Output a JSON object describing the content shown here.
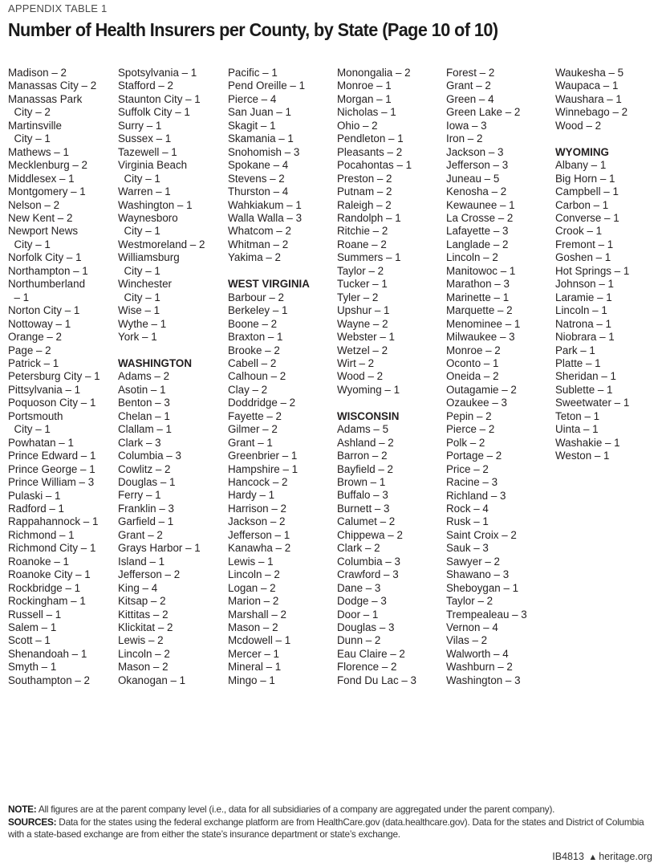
{
  "header": {
    "eyebrow": "APPENDIX TABLE 1",
    "title": "Number of Health Insurers per County, by State (Page 10 of 10)"
  },
  "columns": [
    [
      {
        "type": "entry",
        "text": "Madison – 2"
      },
      {
        "type": "entry",
        "text": "Manassas City – 2"
      },
      {
        "type": "entry",
        "text": "Manassas Park"
      },
      {
        "type": "entry",
        "text": "  City – 2"
      },
      {
        "type": "entry",
        "text": "Martinsville"
      },
      {
        "type": "entry",
        "text": "  City – 1"
      },
      {
        "type": "entry",
        "text": "Mathews – 1"
      },
      {
        "type": "entry",
        "text": "Mecklenburg – 2"
      },
      {
        "type": "entry",
        "text": "Middlesex – 1"
      },
      {
        "type": "entry",
        "text": "Montgomery – 1"
      },
      {
        "type": "entry",
        "text": "Nelson – 2"
      },
      {
        "type": "entry",
        "text": "New Kent – 2"
      },
      {
        "type": "entry",
        "text": "Newport News"
      },
      {
        "type": "entry",
        "text": "  City – 1"
      },
      {
        "type": "entry",
        "text": "Norfolk City – 1"
      },
      {
        "type": "entry",
        "text": "Northampton – 1"
      },
      {
        "type": "entry",
        "text": "Northumberland"
      },
      {
        "type": "entry",
        "text": "  – 1"
      },
      {
        "type": "entry",
        "text": "Norton City – 1"
      },
      {
        "type": "entry",
        "text": "Nottoway – 1"
      },
      {
        "type": "entry",
        "text": "Orange – 2"
      },
      {
        "type": "entry",
        "text": "Page – 2"
      },
      {
        "type": "entry",
        "text": "Patrick – 1"
      },
      {
        "type": "entry",
        "text": "Petersburg City – 1"
      },
      {
        "type": "entry",
        "text": "Pittsylvania – 1"
      },
      {
        "type": "entry",
        "text": "Poquoson City – 1"
      },
      {
        "type": "entry",
        "text": "Portsmouth"
      },
      {
        "type": "entry",
        "text": "  City – 1"
      },
      {
        "type": "entry",
        "text": "Powhatan – 1"
      },
      {
        "type": "entry",
        "text": "Prince Edward – 1"
      },
      {
        "type": "entry",
        "text": "Prince George – 1"
      },
      {
        "type": "entry",
        "text": "Prince William – 3"
      },
      {
        "type": "entry",
        "text": "Pulaski – 1"
      },
      {
        "type": "entry",
        "text": "Radford – 1"
      },
      {
        "type": "entry",
        "text": "Rappahannock – 1"
      },
      {
        "type": "entry",
        "text": "Richmond – 1"
      },
      {
        "type": "entry",
        "text": "Richmond City – 1"
      },
      {
        "type": "entry",
        "text": "Roanoke – 1"
      },
      {
        "type": "entry",
        "text": "Roanoke City – 1"
      },
      {
        "type": "entry",
        "text": "Rockbridge – 1"
      },
      {
        "type": "entry",
        "text": "Rockingham – 1"
      },
      {
        "type": "entry",
        "text": "Russell – 1"
      },
      {
        "type": "entry",
        "text": "Salem – 1"
      },
      {
        "type": "entry",
        "text": "Scott – 1"
      },
      {
        "type": "entry",
        "text": "Shenandoah – 1"
      },
      {
        "type": "entry",
        "text": "Smyth – 1"
      },
      {
        "type": "entry",
        "text": "Southampton – 2"
      }
    ],
    [
      {
        "type": "entry",
        "text": "Spotsylvania – 1"
      },
      {
        "type": "entry",
        "text": "Stafford – 2"
      },
      {
        "type": "entry",
        "text": "Staunton City – 1"
      },
      {
        "type": "entry",
        "text": "Suffolk City – 1"
      },
      {
        "type": "entry",
        "text": "Surry – 1"
      },
      {
        "type": "entry",
        "text": "Sussex – 1"
      },
      {
        "type": "entry",
        "text": "Tazewell – 1"
      },
      {
        "type": "entry",
        "text": "Virginia Beach"
      },
      {
        "type": "entry",
        "text": "  City – 1"
      },
      {
        "type": "entry",
        "text": "Warren – 1"
      },
      {
        "type": "entry",
        "text": "Washington – 1"
      },
      {
        "type": "entry",
        "text": "Waynesboro"
      },
      {
        "type": "entry",
        "text": "  City – 1"
      },
      {
        "type": "entry",
        "text": "Westmoreland – 2"
      },
      {
        "type": "entry",
        "text": "Williamsburg"
      },
      {
        "type": "entry",
        "text": "  City – 1"
      },
      {
        "type": "entry",
        "text": "Winchester"
      },
      {
        "type": "entry",
        "text": "  City – 1"
      },
      {
        "type": "entry",
        "text": "Wise – 1"
      },
      {
        "type": "entry",
        "text": "Wythe – 1"
      },
      {
        "type": "entry",
        "text": "York – 1"
      },
      {
        "type": "gap"
      },
      {
        "type": "state",
        "text": "WASHINGTON"
      },
      {
        "type": "entry",
        "text": "Adams – 2"
      },
      {
        "type": "entry",
        "text": "Asotin – 1"
      },
      {
        "type": "entry",
        "text": "Benton – 3"
      },
      {
        "type": "entry",
        "text": "Chelan – 1"
      },
      {
        "type": "entry",
        "text": "Clallam – 1"
      },
      {
        "type": "entry",
        "text": "Clark – 3"
      },
      {
        "type": "entry",
        "text": "Columbia – 3"
      },
      {
        "type": "entry",
        "text": "Cowlitz – 2"
      },
      {
        "type": "entry",
        "text": "Douglas – 1"
      },
      {
        "type": "entry",
        "text": "Ferry – 1"
      },
      {
        "type": "entry",
        "text": "Franklin – 3"
      },
      {
        "type": "entry",
        "text": "Garfield – 1"
      },
      {
        "type": "entry",
        "text": "Grant – 2"
      },
      {
        "type": "entry",
        "text": "Grays Harbor – 1"
      },
      {
        "type": "entry",
        "text": "Island – 1"
      },
      {
        "type": "entry",
        "text": "Jefferson – 2"
      },
      {
        "type": "entry",
        "text": "King – 4"
      },
      {
        "type": "entry",
        "text": "Kitsap – 2"
      },
      {
        "type": "entry",
        "text": "Kittitas – 2"
      },
      {
        "type": "entry",
        "text": "Klickitat – 2"
      },
      {
        "type": "entry",
        "text": "Lewis – 2"
      },
      {
        "type": "entry",
        "text": "Lincoln – 2"
      },
      {
        "type": "entry",
        "text": "Mason – 2"
      },
      {
        "type": "entry",
        "text": "Okanogan – 1"
      }
    ],
    [
      {
        "type": "entry",
        "text": "Pacific – 1"
      },
      {
        "type": "entry",
        "text": "Pend Oreille – 1"
      },
      {
        "type": "entry",
        "text": "Pierce – 4"
      },
      {
        "type": "entry",
        "text": "San Juan – 1"
      },
      {
        "type": "entry",
        "text": "Skagit – 1"
      },
      {
        "type": "entry",
        "text": "Skamania – 1"
      },
      {
        "type": "entry",
        "text": "Snohomish – 3"
      },
      {
        "type": "entry",
        "text": "Spokane – 4"
      },
      {
        "type": "entry",
        "text": "Stevens – 2"
      },
      {
        "type": "entry",
        "text": "Thurston – 4"
      },
      {
        "type": "entry",
        "text": "Wahkiakum – 1"
      },
      {
        "type": "entry",
        "text": "Walla Walla – 3"
      },
      {
        "type": "entry",
        "text": "Whatcom – 2"
      },
      {
        "type": "entry",
        "text": "Whitman – 2"
      },
      {
        "type": "entry",
        "text": "Yakima – 2"
      },
      {
        "type": "gap"
      },
      {
        "type": "state",
        "text": "WEST VIRGINIA"
      },
      {
        "type": "entry",
        "text": "Barbour – 2"
      },
      {
        "type": "entry",
        "text": "Berkeley – 1"
      },
      {
        "type": "entry",
        "text": "Boone – 2"
      },
      {
        "type": "entry",
        "text": "Braxton – 1"
      },
      {
        "type": "entry",
        "text": "Brooke – 2"
      },
      {
        "type": "entry",
        "text": "Cabell – 2"
      },
      {
        "type": "entry",
        "text": "Calhoun – 2"
      },
      {
        "type": "entry",
        "text": "Clay – 2"
      },
      {
        "type": "entry",
        "text": "Doddridge – 2"
      },
      {
        "type": "entry",
        "text": "Fayette – 2"
      },
      {
        "type": "entry",
        "text": "Gilmer – 2"
      },
      {
        "type": "entry",
        "text": "Grant – 1"
      },
      {
        "type": "entry",
        "text": "Greenbrier – 1"
      },
      {
        "type": "entry",
        "text": "Hampshire – 1"
      },
      {
        "type": "entry",
        "text": "Hancock – 2"
      },
      {
        "type": "entry",
        "text": "Hardy – 1"
      },
      {
        "type": "entry",
        "text": "Harrison – 2"
      },
      {
        "type": "entry",
        "text": "Jackson – 2"
      },
      {
        "type": "entry",
        "text": "Jefferson – 1"
      },
      {
        "type": "entry",
        "text": "Kanawha – 2"
      },
      {
        "type": "entry",
        "text": "Lewis – 1"
      },
      {
        "type": "entry",
        "text": "Lincoln – 2"
      },
      {
        "type": "entry",
        "text": "Logan – 2"
      },
      {
        "type": "entry",
        "text": "Marion – 2"
      },
      {
        "type": "entry",
        "text": "Marshall – 2"
      },
      {
        "type": "entry",
        "text": "Mason – 2"
      },
      {
        "type": "entry",
        "text": "Mcdowell – 1"
      },
      {
        "type": "entry",
        "text": "Mercer – 1"
      },
      {
        "type": "entry",
        "text": "Mineral – 1"
      },
      {
        "type": "entry",
        "text": "Mingo – 1"
      }
    ],
    [
      {
        "type": "entry",
        "text": "Monongalia – 2"
      },
      {
        "type": "entry",
        "text": "Monroe – 1"
      },
      {
        "type": "entry",
        "text": "Morgan – 1"
      },
      {
        "type": "entry",
        "text": "Nicholas – 1"
      },
      {
        "type": "entry",
        "text": "Ohio – 2"
      },
      {
        "type": "entry",
        "text": "Pendleton – 1"
      },
      {
        "type": "entry",
        "text": "Pleasants – 2"
      },
      {
        "type": "entry",
        "text": "Pocahontas – 1"
      },
      {
        "type": "entry",
        "text": "Preston – 2"
      },
      {
        "type": "entry",
        "text": "Putnam – 2"
      },
      {
        "type": "entry",
        "text": "Raleigh – 2"
      },
      {
        "type": "entry",
        "text": "Randolph – 1"
      },
      {
        "type": "entry",
        "text": "Ritchie – 2"
      },
      {
        "type": "entry",
        "text": "Roane – 2"
      },
      {
        "type": "entry",
        "text": "Summers – 1"
      },
      {
        "type": "entry",
        "text": "Taylor – 2"
      },
      {
        "type": "entry",
        "text": "Tucker – 1"
      },
      {
        "type": "entry",
        "text": "Tyler – 2"
      },
      {
        "type": "entry",
        "text": "Upshur – 1"
      },
      {
        "type": "entry",
        "text": "Wayne – 2"
      },
      {
        "type": "entry",
        "text": "Webster – 1"
      },
      {
        "type": "entry",
        "text": "Wetzel – 2"
      },
      {
        "type": "entry",
        "text": "Wirt – 2"
      },
      {
        "type": "entry",
        "text": "Wood – 2"
      },
      {
        "type": "entry",
        "text": "Wyoming – 1"
      },
      {
        "type": "gap"
      },
      {
        "type": "state",
        "text": "WISCONSIN"
      },
      {
        "type": "entry",
        "text": "Adams – 5"
      },
      {
        "type": "entry",
        "text": "Ashland – 2"
      },
      {
        "type": "entry",
        "text": "Barron – 2"
      },
      {
        "type": "entry",
        "text": "Bayfield – 2"
      },
      {
        "type": "entry",
        "text": "Brown – 1"
      },
      {
        "type": "entry",
        "text": "Buffalo – 3"
      },
      {
        "type": "entry",
        "text": "Burnett – 3"
      },
      {
        "type": "entry",
        "text": "Calumet – 2"
      },
      {
        "type": "entry",
        "text": "Chippewa – 2"
      },
      {
        "type": "entry",
        "text": "Clark – 2"
      },
      {
        "type": "entry",
        "text": "Columbia – 3"
      },
      {
        "type": "entry",
        "text": "Crawford – 3"
      },
      {
        "type": "entry",
        "text": "Dane – 3"
      },
      {
        "type": "entry",
        "text": "Dodge – 3"
      },
      {
        "type": "entry",
        "text": "Door – 1"
      },
      {
        "type": "entry",
        "text": "Douglas – 3"
      },
      {
        "type": "entry",
        "text": "Dunn – 2"
      },
      {
        "type": "entry",
        "text": "Eau Claire – 2"
      },
      {
        "type": "entry",
        "text": "Florence – 2"
      },
      {
        "type": "entry",
        "text": "Fond Du Lac – 3"
      }
    ],
    [
      {
        "type": "entry",
        "text": "Forest – 2"
      },
      {
        "type": "entry",
        "text": "Grant – 2"
      },
      {
        "type": "entry",
        "text": "Green – 4"
      },
      {
        "type": "entry",
        "text": "Green Lake – 2"
      },
      {
        "type": "entry",
        "text": "Iowa – 3"
      },
      {
        "type": "entry",
        "text": "Iron – 2"
      },
      {
        "type": "entry",
        "text": "Jackson – 3"
      },
      {
        "type": "entry",
        "text": "Jefferson – 3"
      },
      {
        "type": "entry",
        "text": "Juneau – 5"
      },
      {
        "type": "entry",
        "text": "Kenosha – 2"
      },
      {
        "type": "entry",
        "text": "Kewaunee – 1"
      },
      {
        "type": "entry",
        "text": "La Crosse – 2"
      },
      {
        "type": "entry",
        "text": "Lafayette – 3"
      },
      {
        "type": "entry",
        "text": "Langlade – 2"
      },
      {
        "type": "entry",
        "text": "Lincoln – 2"
      },
      {
        "type": "entry",
        "text": "Manitowoc – 1"
      },
      {
        "type": "entry",
        "text": "Marathon – 3"
      },
      {
        "type": "entry",
        "text": "Marinette – 1"
      },
      {
        "type": "entry",
        "text": "Marquette – 2"
      },
      {
        "type": "entry",
        "text": "Menominee – 1"
      },
      {
        "type": "entry",
        "text": "Milwaukee – 3"
      },
      {
        "type": "entry",
        "text": "Monroe – 2"
      },
      {
        "type": "entry",
        "text": "Oconto – 1"
      },
      {
        "type": "entry",
        "text": "Oneida – 2"
      },
      {
        "type": "entry",
        "text": "Outagamie – 2"
      },
      {
        "type": "entry",
        "text": "Ozaukee – 3"
      },
      {
        "type": "entry",
        "text": "Pepin – 2"
      },
      {
        "type": "entry",
        "text": "Pierce – 2"
      },
      {
        "type": "entry",
        "text": "Polk – 2"
      },
      {
        "type": "entry",
        "text": "Portage – 2"
      },
      {
        "type": "entry",
        "text": "Price – 2"
      },
      {
        "type": "entry",
        "text": "Racine – 3"
      },
      {
        "type": "entry",
        "text": "Richland – 3"
      },
      {
        "type": "entry",
        "text": "Rock – 4"
      },
      {
        "type": "entry",
        "text": "Rusk – 1"
      },
      {
        "type": "entry",
        "text": "Saint Croix – 2"
      },
      {
        "type": "entry",
        "text": "Sauk – 3"
      },
      {
        "type": "entry",
        "text": "Sawyer – 2"
      },
      {
        "type": "entry",
        "text": "Shawano – 3"
      },
      {
        "type": "entry",
        "text": "Sheboygan – 1"
      },
      {
        "type": "entry",
        "text": "Taylor – 2"
      },
      {
        "type": "entry",
        "text": "Trempealeau – 3"
      },
      {
        "type": "entry",
        "text": "Vernon – 4"
      },
      {
        "type": "entry",
        "text": "Vilas – 2"
      },
      {
        "type": "entry",
        "text": "Walworth – 4"
      },
      {
        "type": "entry",
        "text": "Washburn – 2"
      },
      {
        "type": "entry",
        "text": "Washington – 3"
      }
    ],
    [
      {
        "type": "entry",
        "text": "Waukesha – 5"
      },
      {
        "type": "entry",
        "text": "Waupaca – 1"
      },
      {
        "type": "entry",
        "text": "Waushara – 1"
      },
      {
        "type": "entry",
        "text": "Winnebago – 2"
      },
      {
        "type": "entry",
        "text": "Wood – 2"
      },
      {
        "type": "gap"
      },
      {
        "type": "state",
        "text": "WYOMING"
      },
      {
        "type": "entry",
        "text": "Albany – 1"
      },
      {
        "type": "entry",
        "text": "Big Horn – 1"
      },
      {
        "type": "entry",
        "text": "Campbell – 1"
      },
      {
        "type": "entry",
        "text": "Carbon – 1"
      },
      {
        "type": "entry",
        "text": "Converse – 1"
      },
      {
        "type": "entry",
        "text": "Crook – 1"
      },
      {
        "type": "entry",
        "text": "Fremont – 1"
      },
      {
        "type": "entry",
        "text": "Goshen – 1"
      },
      {
        "type": "entry",
        "text": "Hot Springs – 1"
      },
      {
        "type": "entry",
        "text": "Johnson – 1"
      },
      {
        "type": "entry",
        "text": "Laramie – 1"
      },
      {
        "type": "entry",
        "text": "Lincoln – 1"
      },
      {
        "type": "entry",
        "text": "Natrona – 1"
      },
      {
        "type": "entry",
        "text": "Niobrara – 1"
      },
      {
        "type": "entry",
        "text": "Park – 1"
      },
      {
        "type": "entry",
        "text": "Platte – 1"
      },
      {
        "type": "entry",
        "text": "Sheridan – 1"
      },
      {
        "type": "entry",
        "text": "Sublette – 1"
      },
      {
        "type": "entry",
        "text": "Sweetwater – 1"
      },
      {
        "type": "entry",
        "text": "Teton – 1"
      },
      {
        "type": "entry",
        "text": "Uinta – 1"
      },
      {
        "type": "entry",
        "text": "Washakie – 1"
      },
      {
        "type": "entry",
        "text": "Weston – 1"
      }
    ]
  ],
  "footnotes": {
    "note_label": "NOTE:",
    "note_text": " All figures are at the parent company level (i.e., data for all subsidiaries of a company are aggregated under the parent company).",
    "sources_label": "SOURCES:",
    "sources_text": " Data for the states using the federal exchange platform are from HealthCare.gov (data.healthcare.gov). Data for the states and District of Columbia with a state-based exchange are from either the state’s insurance department or state’s exchange."
  },
  "footer": {
    "code": "IB4813",
    "icon": "liberty-bell-icon",
    "site": "heritage.org"
  }
}
